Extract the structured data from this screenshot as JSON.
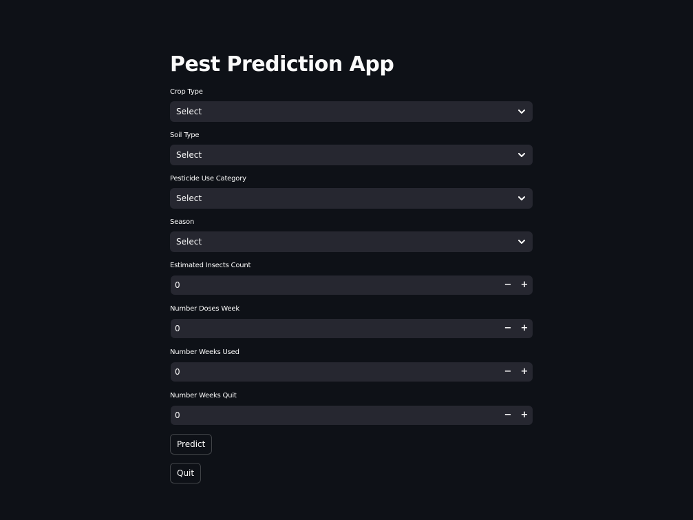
{
  "page": {
    "title": "Pest Prediction App",
    "background_color": "#0e1117",
    "input_background_color": "#262730",
    "text_color": "#fafafa"
  },
  "selects": [
    {
      "label": "Crop Type",
      "value": "Select",
      "icon": "chevron-down-icon"
    },
    {
      "label": "Soil Type",
      "value": "Select",
      "icon": "chevron-down-icon"
    },
    {
      "label": "Pesticide Use Category",
      "value": "Select",
      "icon": "chevron-down-icon"
    },
    {
      "label": "Season",
      "value": "Select",
      "icon": "chevron-down-icon"
    }
  ],
  "number_inputs": [
    {
      "label": "Estimated Insects Count",
      "value": "0",
      "decrement": "−",
      "increment": "+"
    },
    {
      "label": "Number Doses Week",
      "value": "0",
      "decrement": "−",
      "increment": "+"
    },
    {
      "label": "Number Weeks Used",
      "value": "0",
      "decrement": "−",
      "increment": "+"
    },
    {
      "label": "Number Weeks Quit",
      "value": "0",
      "decrement": "−",
      "increment": "+"
    }
  ],
  "buttons": {
    "predict": "Predict",
    "quit": "Quit"
  }
}
